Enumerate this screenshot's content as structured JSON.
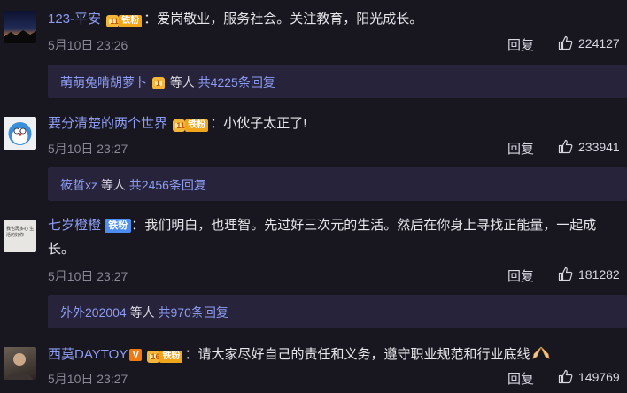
{
  "comments": [
    {
      "username": "123-平安",
      "badge_level": "11",
      "badge_label": "铁粉",
      "text": "：爱岗敬业，服务社会。关注教育，阳光成长。",
      "time": "5月10日 23:26",
      "reply_label": "回复",
      "likes": "224127",
      "sub": {
        "names": "萌萌兔啃胡萝卜",
        "others": "等人",
        "count": "共4225条回复",
        "has_badge": true
      }
    },
    {
      "username": "要分清楚的两个世界",
      "badge_level": "11",
      "badge_label": "铁粉",
      "text": "：小伙子太正了!",
      "time": "5月10日 23:27",
      "reply_label": "回复",
      "likes": "233941",
      "sub": {
        "names": "筱晢xz",
        "others": "等人",
        "count": "共2456条回复"
      }
    },
    {
      "username": "七岁橙橙",
      "badge_label": "铁粉",
      "text_line1": "：我们明白，也理智。先过好三次元的生活。然后在你身上寻找正能量，一起成",
      "text_line2": "长。",
      "avatar_text": "我也再多心 生活的好你",
      "time": "5月10日 23:27",
      "reply_label": "回复",
      "likes": "181282",
      "sub": {
        "names": "外外202004",
        "others": "等人",
        "count": "共970条回复"
      }
    },
    {
      "username": "西莫DAYTOY",
      "verified": "V",
      "badge_level": "16",
      "badge_label": "铁粉",
      "text": "：请大家尽好自己的责任和义务，遵守职业规范和行业底线",
      "time": "5月10日 23:27",
      "reply_label": "回复",
      "likes": "149769"
    }
  ],
  "colors": {
    "bg": "#18161f",
    "name": "#8d9cf2",
    "subbox": "#26233a",
    "meta": "#8a8796"
  }
}
